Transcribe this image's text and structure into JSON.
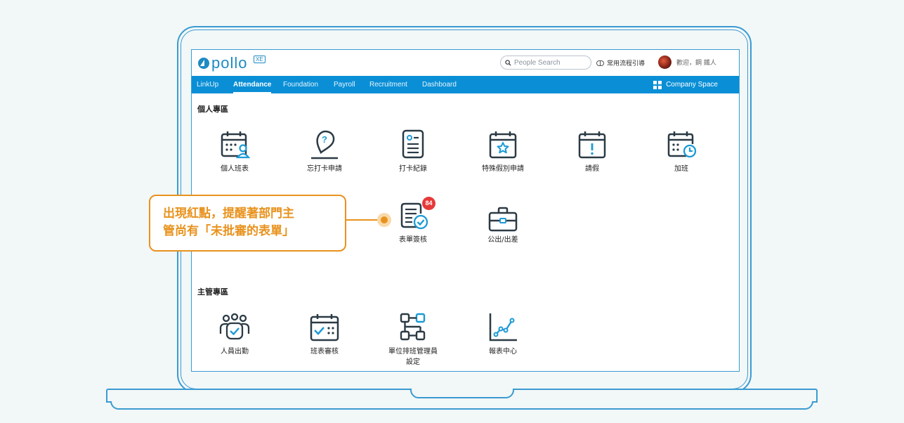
{
  "header": {
    "logo_text": "pollo",
    "logo_badge": "XE",
    "search_placeholder": "People Search",
    "guide_label": "常用流程引導",
    "user_greeting": "歡迎，鋼 鐵人"
  },
  "nav": {
    "items": [
      {
        "label": "LinkUp",
        "active": false
      },
      {
        "label": "Attendance",
        "active": true
      },
      {
        "label": "Foundation",
        "active": false
      },
      {
        "label": "Payroll",
        "active": false
      },
      {
        "label": "Recruitment",
        "active": false
      },
      {
        "label": "Dashboard",
        "active": false
      }
    ],
    "company_space": "Company Space"
  },
  "personal": {
    "title": "個人專區",
    "tiles": [
      {
        "label": "個人班表",
        "icon": "calendar-person-icon"
      },
      {
        "label": "忘打卡申請",
        "icon": "map-pin-question-icon"
      },
      {
        "label": "打卡紀錄",
        "icon": "clipboard-list-icon"
      },
      {
        "label": "特殊假別申請",
        "icon": "calendar-star-icon"
      },
      {
        "label": "請假",
        "icon": "calendar-alert-icon"
      },
      {
        "label": "加班",
        "icon": "calendar-clock-icon"
      },
      {
        "label": "表單簽核",
        "icon": "form-approve-icon",
        "badge": "84"
      },
      {
        "label": "公出/出差",
        "icon": "briefcase-icon"
      }
    ]
  },
  "manager": {
    "title": "主管專區",
    "tiles": [
      {
        "label": "人員出勤",
        "icon": "people-check-icon"
      },
      {
        "label": "班表審核",
        "icon": "calendar-check-icon"
      },
      {
        "label": "單位排班管理員設定",
        "icon": "org-chart-icon"
      },
      {
        "label": "報表中心",
        "icon": "line-chart-icon"
      }
    ]
  },
  "callout": {
    "line1": "出現紅點，提醒著部門主",
    "line2": "管尚有「未批審的表單」"
  },
  "colors": {
    "accent": "#0a8fd6",
    "callout": "#e8921d",
    "badge": "#e63a3a",
    "icon_dark": "#2b3a45",
    "icon_blue": "#1d9ad6"
  }
}
